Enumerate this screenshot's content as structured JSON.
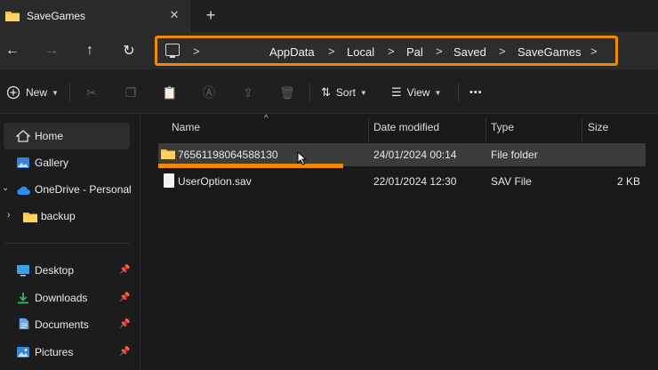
{
  "window": {
    "tab_title": "SaveGames",
    "close_glyph": "✕",
    "new_tab_glyph": "+"
  },
  "nav": {
    "back_glyph": "←",
    "forward_glyph": "→",
    "up_glyph": "↑",
    "refresh_glyph": "↻",
    "breadcrumbs": [
      "AppData",
      "Local",
      "Pal",
      "Saved",
      "SaveGames"
    ],
    "highlight_color": "#f08a00"
  },
  "toolbar": {
    "new_label": "New",
    "sort_label": "Sort",
    "view_label": "View",
    "more_glyph": "•••"
  },
  "sidebar": {
    "items": [
      {
        "label": "Home",
        "icon": "home-icon"
      },
      {
        "label": "Gallery",
        "icon": "gallery-icon"
      },
      {
        "label": "OneDrive - Personal",
        "icon": "cloud-icon"
      },
      {
        "label": "backup",
        "icon": "folder-icon"
      },
      {
        "label": "Desktop",
        "icon": "desktop-icon"
      },
      {
        "label": "Downloads",
        "icon": "download-icon"
      },
      {
        "label": "Documents",
        "icon": "documents-icon"
      },
      {
        "label": "Pictures",
        "icon": "pictures-icon"
      }
    ],
    "pin_glyph": "📌"
  },
  "table": {
    "columns": [
      "Name",
      "Date modified",
      "Type",
      "Size"
    ],
    "rows": [
      {
        "name": "76561198064588130",
        "date": "24/01/2024 00:14",
        "type": "File folder",
        "size": "",
        "kind": "folder"
      },
      {
        "name": "UserOption.sav",
        "date": "22/01/2024 12:30",
        "type": "SAV File",
        "size": "2 KB",
        "kind": "file"
      }
    ]
  }
}
